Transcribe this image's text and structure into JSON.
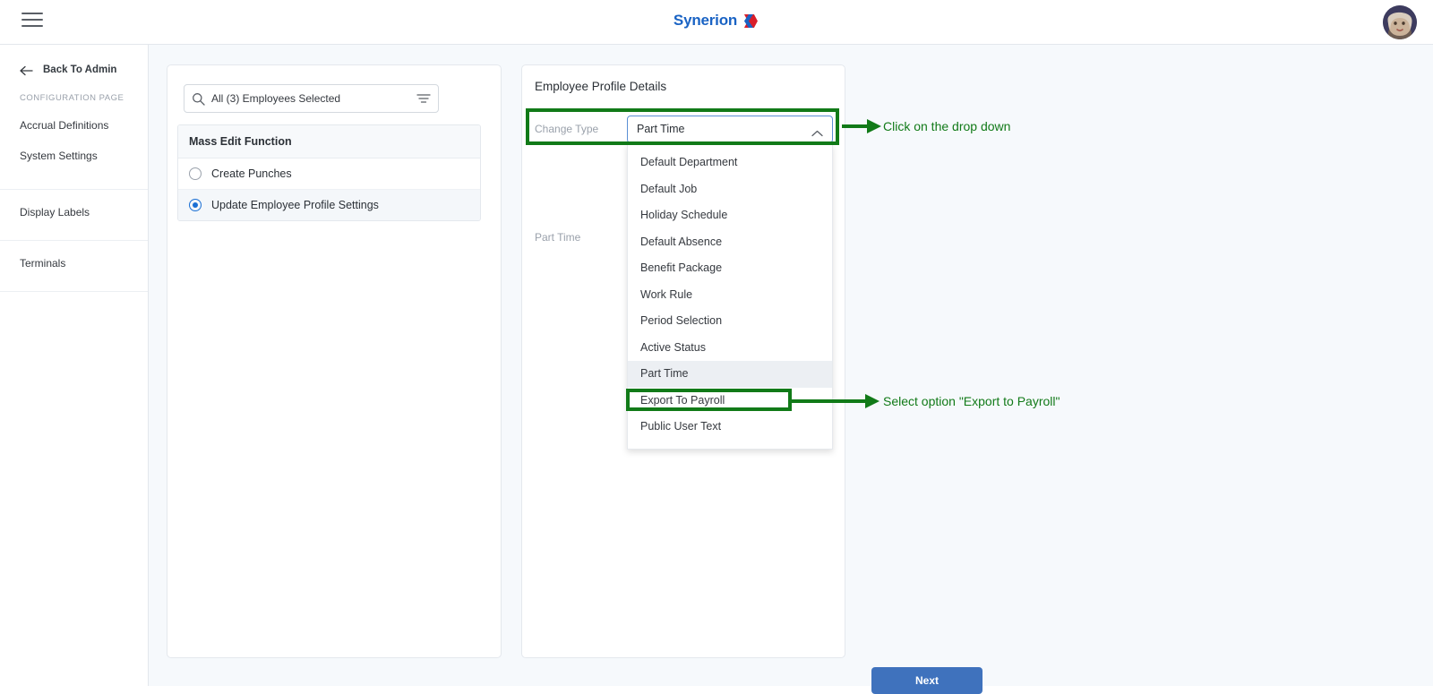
{
  "header": {
    "menu_icon": "hamburger-icon",
    "brand_name": "Synerion",
    "brand_color": "#1a63c4",
    "avatar_alt": "user-avatar"
  },
  "sidebar": {
    "back_link": "Back To Admin",
    "section_caption": "CONFIGURATION PAGE",
    "groups": [
      {
        "items": [
          {
            "label": "Accrual Definitions"
          },
          {
            "label": "System Settings"
          }
        ]
      },
      {
        "items": [
          {
            "label": "Display Labels"
          }
        ]
      },
      {
        "items": [
          {
            "label": "Terminals"
          }
        ]
      }
    ]
  },
  "left_card": {
    "search": {
      "value": "All (3) Employees Selected",
      "placeholder": "Search employees",
      "search_icon": "search-icon",
      "filter_icon": "filter-icon"
    },
    "mass_edit": {
      "header": "Mass Edit Function",
      "options": [
        {
          "label": "Create Punches",
          "selected": false
        },
        {
          "label": "Update Employee Profile Settings",
          "selected": true
        }
      ]
    }
  },
  "right_card": {
    "title": "Employee Profile Details",
    "change_type": {
      "label": "Change Type",
      "value": "Part Time",
      "chevron": "chevron-up-icon",
      "expanded": true
    },
    "secondary_label": "Part Time",
    "next_button": "Next",
    "next_button_color": "#3f72bd"
  },
  "dropdown": {
    "options": [
      {
        "label": "Default Department",
        "active": false
      },
      {
        "label": "Default Job",
        "active": false
      },
      {
        "label": "Holiday Schedule",
        "active": false
      },
      {
        "label": "Default Absence",
        "active": false
      },
      {
        "label": "Benefit Package",
        "active": false
      },
      {
        "label": "Work Rule",
        "active": false
      },
      {
        "label": "Period Selection",
        "active": false
      },
      {
        "label": "Active Status",
        "active": false
      },
      {
        "label": "Part Time",
        "active": true
      },
      {
        "label": "Export To Payroll",
        "active": false
      },
      {
        "label": "Public User Text",
        "active": false
      }
    ]
  },
  "annotations": {
    "color": "#117a18",
    "items": [
      {
        "text": "Click on the drop down"
      },
      {
        "text": "Select option \"Export to Payroll\""
      }
    ]
  }
}
